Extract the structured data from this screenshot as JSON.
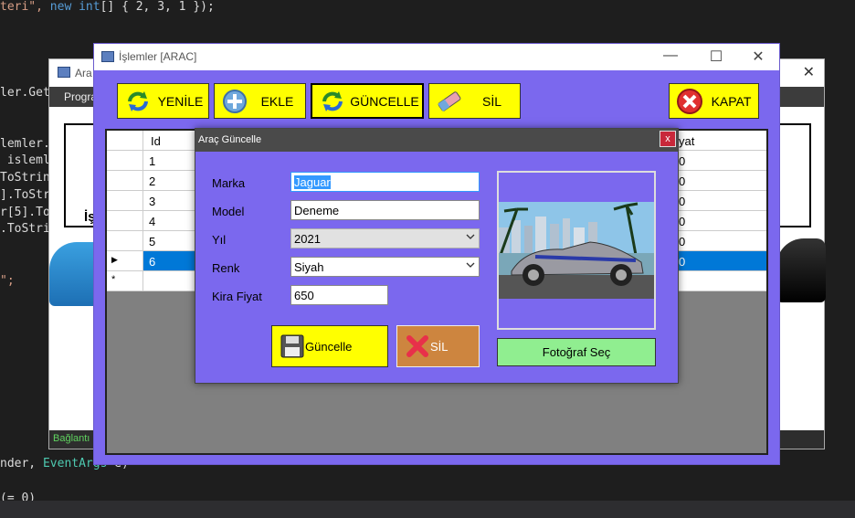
{
  "code_lines": [
    {
      "parts": [
        {
          "t": "teri\", ",
          "c": "str"
        },
        {
          "t": "new ",
          "c": "kw"
        },
        {
          "t": "int",
          "c": "kw"
        },
        {
          "t": "[] { 2, 3, 1 });",
          "c": ""
        }
      ]
    },
    {
      "parts": [
        {
          "t": "ler.Get",
          "c": ""
        }
      ]
    },
    {
      "parts": [
        {
          "t": "lemler.",
          "c": ""
        }
      ]
    },
    {
      "parts": [
        {
          "t": " isleml",
          "c": ""
        }
      ]
    },
    {
      "parts": [
        {
          "t": "ToStrin",
          "c": ""
        }
      ]
    },
    {
      "parts": [
        {
          "t": "].ToStr",
          "c": ""
        }
      ]
    },
    {
      "parts": [
        {
          "t": "r[5].To",
          "c": ""
        }
      ]
    },
    {
      "parts": [
        {
          "t": ".ToStri",
          "c": ""
        }
      ]
    },
    {
      "parts": [
        {
          "t": "\";",
          "c": "str"
        }
      ]
    },
    {
      "parts": [
        {
          "t": "nder, ",
          "c": ""
        },
        {
          "t": "EventArgs",
          "c": "typ"
        },
        {
          "t": " e)",
          "c": ""
        }
      ]
    },
    {
      "parts": [
        {
          "t": "(= 0)",
          "c": ""
        }
      ]
    }
  ],
  "bg_window": {
    "title": "Ara",
    "menu": "Progra",
    "status": "Bağlantı",
    "partial_label": "İş"
  },
  "main_window": {
    "title": "İşlemler [ARAC]",
    "toolbar": {
      "refresh": "YENİLE",
      "add": "EKLE",
      "update": "GÜNCELLE",
      "delete": "SİL",
      "close": "KAPAT"
    }
  },
  "grid": {
    "col_id": "Id",
    "col_price_partial": "yat",
    "rows": [
      {
        "id": "1",
        "price": "0"
      },
      {
        "id": "2",
        "price": "0"
      },
      {
        "id": "3",
        "price": "0"
      },
      {
        "id": "4",
        "price": "0"
      },
      {
        "id": "5",
        "price": "0"
      },
      {
        "id": "6",
        "price": "0"
      }
    ],
    "selected_row": 5,
    "new_row_marker": "*",
    "current_row_marker": "▶"
  },
  "dialog": {
    "title": "Araç Güncelle",
    "close": "x",
    "fields": {
      "brand_label": "Marka",
      "brand_value": "Jaguar",
      "model_label": "Model",
      "model_value": "Deneme",
      "year_label": "Yıl",
      "year_value": "2021",
      "color_label": "Renk",
      "color_value": "Siyah",
      "price_label": "Kira Fiyat",
      "price_value": "650"
    },
    "update_button": "Güncelle",
    "delete_button": "SİL",
    "photo_button": "Fotoğraf Seç"
  },
  "colors": {
    "accent": "#7b68ee",
    "button_yellow": "#ffff00",
    "delete_orange": "#cd853f",
    "photo_green": "#90ee90",
    "selection_blue": "#0078d7"
  }
}
